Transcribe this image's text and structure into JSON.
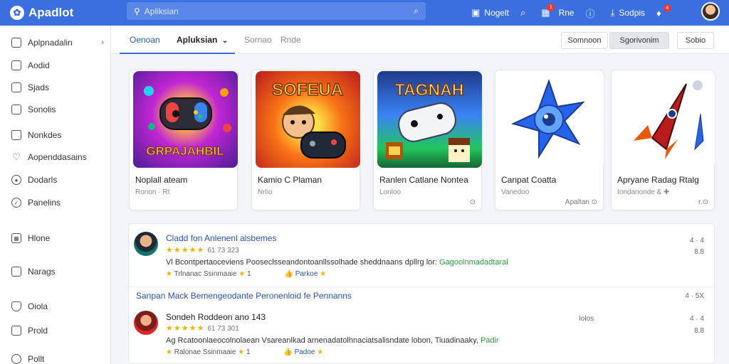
{
  "app": {
    "title": "Apadlot"
  },
  "search": {
    "placeholder": "Apliksian",
    "icon": "search-icon"
  },
  "top_actions": [
    {
      "label": "Nogelt",
      "icon": "browser-icon"
    },
    {
      "label": "",
      "icon": "search-icon"
    },
    {
      "label": "Rne",
      "icon": "store-icon",
      "badge": "1"
    },
    {
      "label": "",
      "icon": "info-icon"
    },
    {
      "label": "Sodpis",
      "icon": "download-icon"
    },
    {
      "label": "",
      "icon": "bell-icon",
      "badge": "4"
    }
  ],
  "sidebar": {
    "items": [
      {
        "label": "Aplpnadalin",
        "icon": "home-icon",
        "chevron": "›"
      },
      {
        "label": "Aodid",
        "icon": "android-icon"
      },
      {
        "label": "Sjads",
        "icon": "tablet-icon"
      },
      {
        "label": "Sonolis",
        "icon": "folder-icon"
      },
      {
        "label": "Nonkdes",
        "icon": "house-icon"
      },
      {
        "label": "Aopenddasains",
        "icon": "heart-icon"
      },
      {
        "label": "Dodarls",
        "icon": "target-icon"
      },
      {
        "label": "Panelins",
        "icon": "check-circle-icon"
      },
      {
        "label": "Hlone",
        "icon": "grid-icon"
      },
      {
        "label": "Narags",
        "icon": "bag-icon"
      },
      {
        "label": "Oiola",
        "icon": "shield-icon"
      },
      {
        "label": "Prold",
        "icon": "lock-icon"
      },
      {
        "label": "Pollt",
        "icon": "user-icon"
      }
    ]
  },
  "tabs": [
    {
      "label": "Oenoan",
      "state": "active"
    },
    {
      "label": "Apluksian",
      "state": "bold",
      "chevron": "⌄"
    },
    {
      "label": "Sornao",
      "state": "normal"
    },
    {
      "label": "Rnde",
      "state": "normal"
    }
  ],
  "header_buttons": [
    {
      "label": "Somnoon"
    },
    {
      "label": "Sgorivonim"
    },
    {
      "label": "Sobio"
    }
  ],
  "apps": [
    {
      "title": "Noplall ateam",
      "sub": "Ronon  ·  Rt",
      "foot": "",
      "thumb_text": "GRPAJAHBIL",
      "thumb_theme": "purple"
    },
    {
      "title": "Kamio C Plaman",
      "sub": "Nrlio",
      "foot": "",
      "thumb_text": "SOFEUA",
      "thumb_theme": "orange"
    },
    {
      "title": "Ranlen Catlane Nontea",
      "sub": "Lonloo",
      "foot": "⊙",
      "thumb_text": "TAGNAH",
      "thumb_theme": "green"
    },
    {
      "title": "Canpat Coatta",
      "sub": "Vanedoo",
      "foot": "Apaltan ⊙",
      "thumb_text": "",
      "thumb_theme": "star"
    },
    {
      "title": "Apryane Radag Rtalg",
      "sub": "Iondanonde & ✚",
      "foot": "r.⊙",
      "thumb_text": "",
      "thumb_theme": "rocket"
    }
  ],
  "reviews": [
    {
      "name": "Cladd fon Anlenenl alsbemes",
      "stars": "★★★★★",
      "rating_text": "61 73 323",
      "body": "Vl Bcontpertaoceviens Pooseclsseandontoanllssolhade sheddnaans dpllrg lor: ",
      "body_highlight": "Gagoolnmadadtaral",
      "meta_left": "Trlnanac Ssinmaaie",
      "meta_count": "1",
      "meta_link": "Parkoe",
      "side_top": "4 · 4",
      "side_bottom": "8.8"
    },
    {
      "name": "Sondeh Roddeon ano 143",
      "stars": "★★★★★",
      "rating_text": "61 73 301",
      "body": "Ag Rcatoonlaeocolnolaean Vsareanlkad arnenadatolhnaciatsalisndate lobon, Tiuadinaaky, ",
      "body_highlight": "Padir",
      "meta_left": "Ralonae Ssinmaaie",
      "meta_count": "1",
      "meta_link": "Padoe",
      "side_top": "Iolos",
      "side_right": "4 · 4",
      "side_bottom": "8.8"
    }
  ],
  "section_title": "Sanpan Mack Bemengeodante Peronenloid fe Pennanns",
  "section_side": "4 · 5X",
  "colors": {
    "accent": "#3b6fe0",
    "link": "#2950b8",
    "star": "#f0b400",
    "highlight": "#2c9b3a"
  }
}
